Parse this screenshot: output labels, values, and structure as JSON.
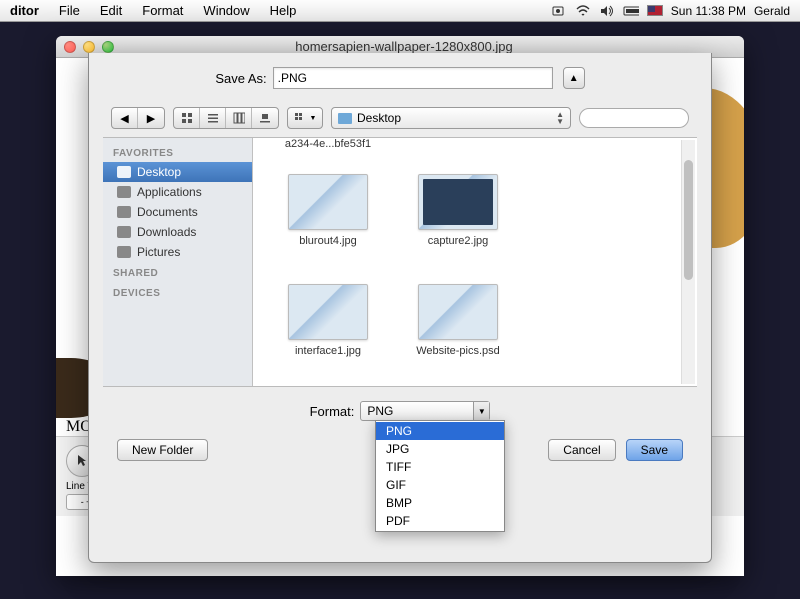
{
  "menubar": {
    "app": "ditor",
    "items": [
      "File",
      "Edit",
      "Format",
      "Window",
      "Help"
    ],
    "clock": "Sun 11:38 PM",
    "user": "Gerald"
  },
  "parent_window": {
    "title": "homersapien-wallpaper-1280x800.jpg",
    "bg_label": "MO",
    "line_width_label": "Line Wi",
    "stepper_val": "- ÷"
  },
  "sheet": {
    "saveas_label": "Save As:",
    "saveas_value": ".PNG",
    "path_label": "Desktop",
    "search_placeholder": "",
    "sidebar": {
      "favorites_header": "FAVORITES",
      "items": [
        {
          "label": "Desktop",
          "selected": true
        },
        {
          "label": "Applications",
          "selected": false
        },
        {
          "label": "Documents",
          "selected": false
        },
        {
          "label": "Downloads",
          "selected": false
        },
        {
          "label": "Pictures",
          "selected": false
        }
      ],
      "shared_header": "SHARED",
      "devices_header": "DEVICES"
    },
    "files": {
      "top_partial": "a234-4e...bfe53f1",
      "items": [
        {
          "label": "blurout4.jpg"
        },
        {
          "label": "capture2.jpg"
        },
        {
          "label": "interface1.jpg"
        },
        {
          "label": "Website-pics.psd"
        }
      ]
    },
    "format_label": "Format:",
    "format_value": "PNG",
    "format_options": [
      "PNG",
      "JPG",
      "TIFF",
      "GIF",
      "BMP",
      "PDF"
    ],
    "new_folder": "New Folder",
    "cancel": "Cancel",
    "save": "Save"
  }
}
